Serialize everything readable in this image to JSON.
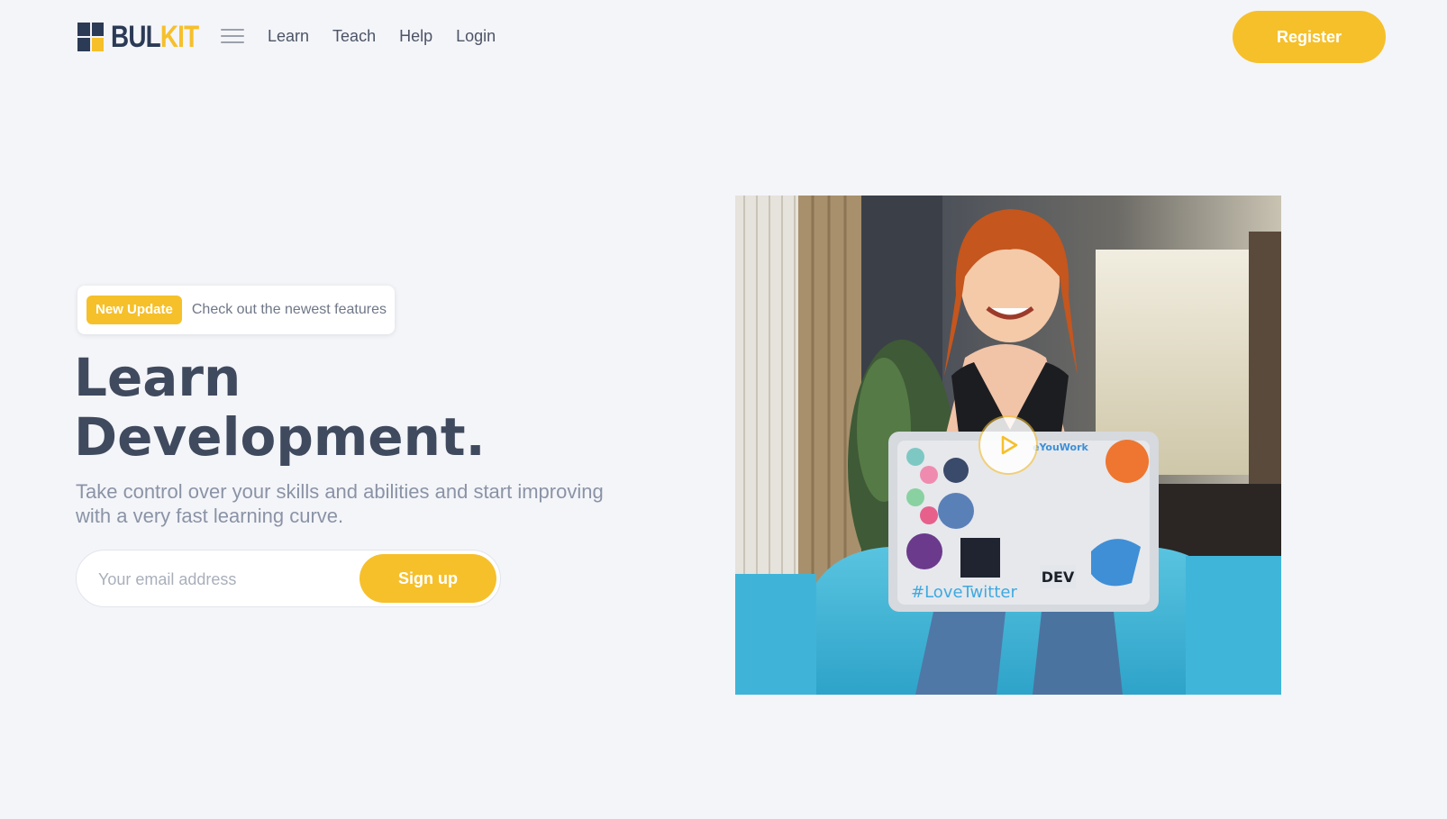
{
  "brand": {
    "name_part1": "BUL",
    "name_part2": "KIT",
    "accent": "#f6c02b",
    "dark": "#2b3a55"
  },
  "nav": {
    "items": [
      "Learn",
      "Teach",
      "Help",
      "Login"
    ],
    "register_label": "Register"
  },
  "hero": {
    "badge_label": "New Update",
    "badge_text": "Check out the newest features",
    "title_line1": "Learn",
    "title_line2": "Development.",
    "subtitle": "Take control over your skills and abilities and start improving with a very fast learning curve.",
    "email_placeholder": "Your email address",
    "signup_label": "Sign up"
  },
  "media": {
    "sticker_hashtag": "#LoveTwitter",
    "sticker_dev": "DEV",
    "sticker_top": "eYouWork"
  },
  "icons": [
    "logo-mark-icon",
    "hamburger-menu-icon",
    "play-icon"
  ]
}
